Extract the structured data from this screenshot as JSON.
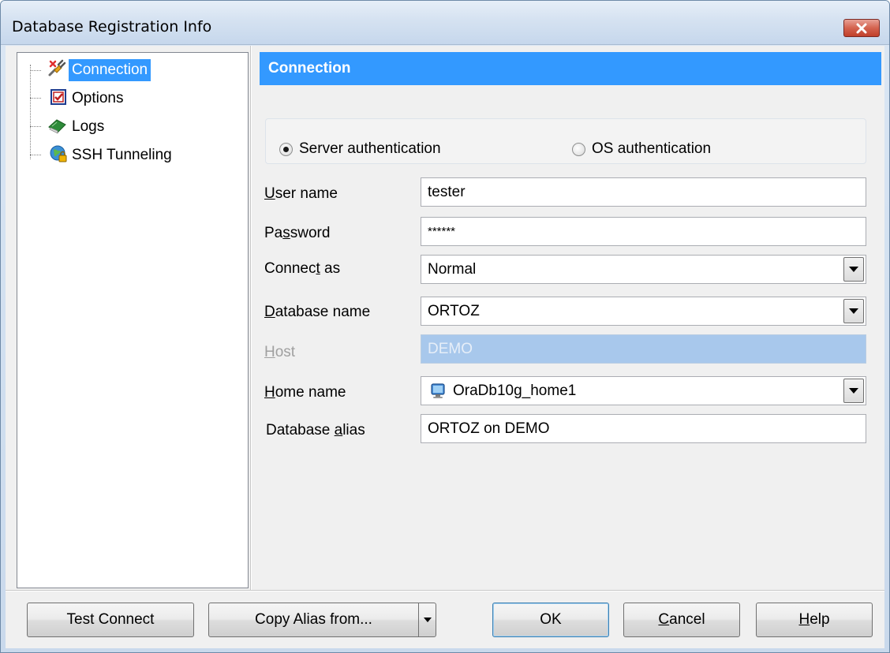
{
  "window": {
    "title": "Database Registration Info"
  },
  "tree": {
    "items": [
      {
        "label": "Connection",
        "icon": "connection-plug-icon",
        "selected": true
      },
      {
        "label": "Options",
        "icon": "options-checkbox-icon",
        "selected": false
      },
      {
        "label": "Logs",
        "icon": "logs-book-icon",
        "selected": false
      },
      {
        "label": "SSH Tunneling",
        "icon": "ssh-globe-lock-icon",
        "selected": false
      }
    ]
  },
  "section": {
    "title": "Connection"
  },
  "auth": {
    "server_label": "Server authentication",
    "os_label": "OS authentication",
    "selected": "server"
  },
  "fields": {
    "user_name": {
      "label_pre": "",
      "label_u": "U",
      "label_post": "ser name",
      "value": "tester"
    },
    "password": {
      "label_pre": "Pa",
      "label_u": "s",
      "label_post": "sword",
      "value": "******"
    },
    "connect_as": {
      "label_pre": "Connec",
      "label_u": "t",
      "label_post": " as",
      "value": "Normal"
    },
    "database_name": {
      "label_pre": "",
      "label_u": "D",
      "label_post": "atabase name",
      "value": "ORTOZ"
    },
    "host": {
      "label_pre": "",
      "label_u": "H",
      "label_post": "ost",
      "value": "DEMO"
    },
    "home_name": {
      "label_pre": "",
      "label_u": "H",
      "label_post": "ome name",
      "value": "OraDb10g_home1",
      "icon": "computer-monitor-icon"
    },
    "database_alias": {
      "label_pre": "Database ",
      "label_u": "a",
      "label_post": "lias",
      "value": "ORTOZ on DEMO"
    }
  },
  "buttons": {
    "test_connect": "Test Connect",
    "copy_alias": "Copy Alias from...",
    "ok": "OK",
    "cancel_u": "C",
    "cancel_rest": "ancel",
    "help_u": "H",
    "help_rest": "elp"
  },
  "colors": {
    "selection": "#3399ff",
    "disabled_field": "#a8c8ec",
    "client_bg": "#f0f0f0",
    "close_button": "#c8452f"
  }
}
